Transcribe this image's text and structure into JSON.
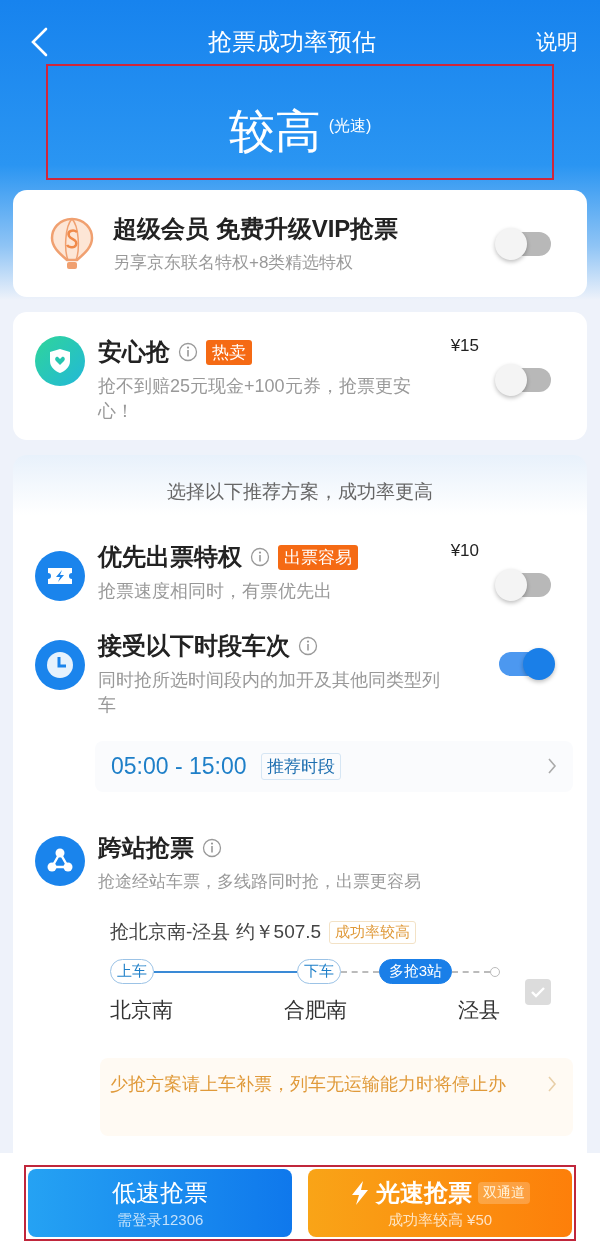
{
  "nav": {
    "title": "抢票成功率预估",
    "action": "说明"
  },
  "estimate": {
    "result": "较高",
    "mode": "(光速)"
  },
  "vip": {
    "title": "超级会员 免费升级VIP抢票",
    "subtitle": "另享京东联名特权+8类精选特权",
    "on": false
  },
  "insurance": {
    "title": "安心抢",
    "badge": "热卖",
    "price": "¥15",
    "desc": "抢不到赔25元现金+100元券，抢票更安心！",
    "on": false
  },
  "recommend": {
    "heading": "选择以下推荐方案，成功率更高",
    "priority": {
      "title": "优先出票特权",
      "badge": "出票容易",
      "price": "¥10",
      "desc": "抢票速度相同时，有票优先出",
      "on": false
    },
    "timeslot": {
      "title": "接受以下时段车次",
      "desc": "同时抢所选时间段内的加开及其他同类型列车",
      "on": true,
      "range": "05:00 - 15:00",
      "tag": "推荐时段"
    },
    "cross_station": {
      "title": "跨站抢票",
      "desc": "抢途经站车票，多线路同时抢，出票更容易",
      "route": "抢北京南-泾县 约￥507.5",
      "tag": "成功率较高",
      "pills": [
        "上车",
        "下车",
        "多抢3站"
      ],
      "stations": [
        "北京南",
        "合肥南",
        "泾县"
      ],
      "checked": true,
      "disabled": true,
      "notice": "少抢方案请上车补票，列车无运输能力时将停止办"
    }
  },
  "buttons": [
    {
      "kind": "slow",
      "label": "低速抢票",
      "sub": "需登录12306"
    },
    {
      "kind": "fast",
      "label": "光速抢票",
      "tag": "双通道",
      "sub": "成功率较高 ¥50"
    }
  ]
}
